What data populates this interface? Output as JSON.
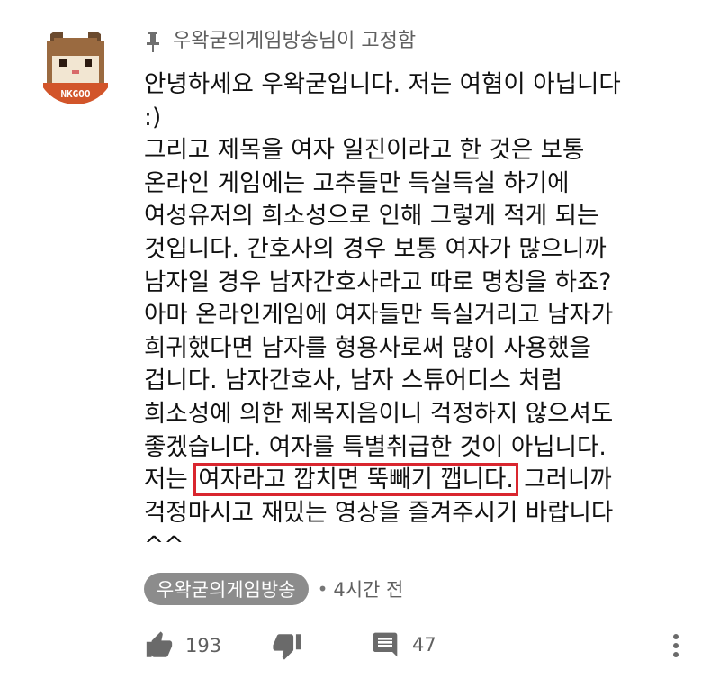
{
  "pinned": {
    "label": "우왁굳의게임방송님이 고정함"
  },
  "avatar": {
    "badge_text": "NKGOO"
  },
  "comment": {
    "lines": [
      "안녕하세요 우왁굳입니다. 저는 여혐이 아닙니다",
      ":)",
      "그리고 제목을 여자 일진이라고 한 것은 보통",
      "온라인 게임에는 고추들만 득실득실 하기에",
      "여성유저의 희소성으로 인해 그렇게 적게 되는",
      "것입니다. 간호사의 경우 보통 여자가 많으니까",
      "남자일 경우 남자간호사라고 따로 명칭을 하죠?",
      "아마 온라인게임에 여자들만 득실거리고 남자가",
      "희귀했다면 남자를 형용사로써 많이 사용했을",
      "겁니다. 남자간호사, 남자 스튜어디스 처럼",
      "희소성에 의한 제목지음이니 걱정하지 않으셔도",
      "좋겠습니다. 여자를 특별취급한 것이 아닙니다."
    ],
    "highlight_line": {
      "before": "저는 ",
      "highlighted": "여자라고 깝치면 뚝빼기 깹니다.",
      "after": " 그러니까"
    },
    "tail_lines": [
      "걱정마시고 재밌는 영상을 즐겨주시기 바랍니다",
      "^^"
    ]
  },
  "meta": {
    "author": "우왁굳의게임방송",
    "separator": "•",
    "time": "4시간 전"
  },
  "actions": {
    "like_count": "193",
    "reply_count": "47"
  },
  "icons": {
    "pin": "pin-icon",
    "like": "thumbs-up-icon",
    "dislike": "thumbs-down-icon",
    "reply": "comment-icon",
    "more": "more-vert-icon"
  }
}
